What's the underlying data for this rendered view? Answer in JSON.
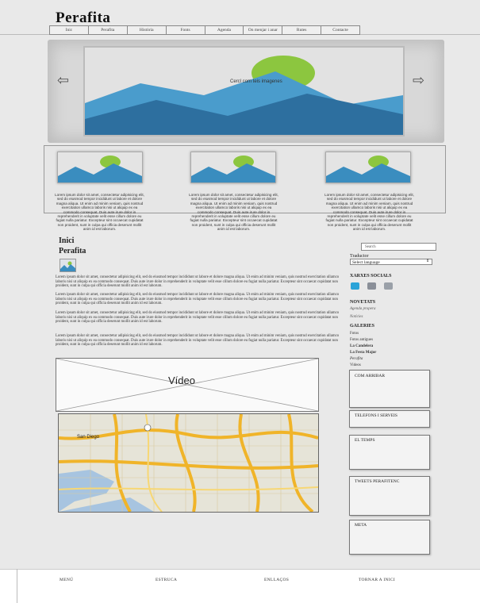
{
  "header": {
    "title": "Perafita"
  },
  "nav": {
    "items": [
      "Inic",
      "Perafita",
      "Història",
      "Fonts",
      "Agenda",
      "On menjar i anar",
      "Rutes",
      "Contacte"
    ]
  },
  "banner": {
    "caption": "Cercl com teis imagenes",
    "prev_icon": "arrow-left-icon",
    "next_icon": "arrow-right-icon"
  },
  "thumbs": [
    {
      "text": "Lorem ipsum dolor sit amet, consectetur adipisicing elit, sed do eiusmod tempor incididunt ut labore et dolore magna aliqua. Ut enim ad minim veniam, quis nostrud exercitation ullamco laboris nisi ut aliquip ex ea commodo consequat. Duis aute irure dolor in reprehenderit in voluptate velit esse cillum dolore eu fugiat nulla pariatur. Excepteur sint occaecat cupidatat non proident, sunt in culpa qui officia deserunt mollit anim id est laborum."
    },
    {
      "text": "Lorem ipsum dolor sit amet, consectetur adipisicing elit, sed do eiusmod tempor incididunt ut labore et dolore magna aliqua. Ut enim ad minim veniam, quis nostrud exercitation ullamco laboris nisi ut aliquip ex ea commodo consequat. Duis aute irure dolor in reprehenderit in voluptate velit esse cillum dolore eu fugiat nulla pariatur. Excepteur sint occaecat cupidatat non proident, sunt in culpa qui officia deserunt mollit anim id est laborum."
    },
    {
      "text": "Lorem ipsum dolor sit amet, consectetur adipisicing elit, sed do eiusmod tempor incididunt ut labore et dolore magna aliqua. Ut enim ad minim veniam, quis nostrud exercitation ullamco laboris nisi ut aliquip ex ea commodo consequat. Duis aute irure dolor in reprehenderit in voluptate velit esse cillum dolore eu fugiat nulla pariatur. Excepteur sint occaecat cupidatat non proident, sunt in culpa qui officia deserunt mollit anim id est laborum."
    }
  ],
  "main": {
    "title1": "Inici",
    "title2": "Perafita",
    "paragraphs": [
      "Lorem ipsum dolor sit amet, consectetur adipisicing elit, sed do eiusmod tempor incididunt ut labore et dolore magna aliqua. Ut enim ad minim veniam, quis nostrud exercitation ullamco laboris nisi ut aliquip ex ea commodo consequat. Duis aute irure dolor in reprehenderit in voluptate velit esse cillum dolore eu fugiat nulla pariatur. Excepteur sint occaecat cupidatat non proident, sunt in culpa qui officia deserunt mollit anim id est laborum.",
      "Lorem ipsum dolor sit amet, consectetur adipisicing elit, sed do eiusmod tempor incididunt ut labore et dolore magna aliqua. Ut enim ad minim veniam, quis nostrud exercitation ullamco laboris nisi ut aliquip ex ea commodo consequat. Duis aute irure dolor in reprehenderit in voluptate velit esse cillum dolore eu fugiat nulla pariatur. Excepteur sint occaecat cupidatat non proident, sunt in culpa qui officia deserunt mollit anim id est laborum.",
      "Lorem ipsum dolor sit amet, consectetur adipisicing elit, sed do eiusmod tempor incididunt ut labore et dolore magna aliqua. Ut enim ad minim veniam, quis nostrud exercitation ullamco laboris nisi ut aliquip ex ea commodo consequat. Duis aute irure dolor in reprehenderit in voluptate velit esse cillum dolore eu fugiat nulla pariatur. Excepteur sint occaecat cupidatat non proident, sunt in culpa qui officia deserunt mollit anim id est laborum.",
      "Lorem ipsum dolor sit amet, consectetur adipisicing elit, sed do eiusmod tempor incididunt ut labore et dolore magna aliqua. Ut enim ad minim veniam, quis nostrud exercitation ullamco laboris nisi ut aliquip ex ea commodo consequat. Duis aute irure dolor in reprehenderit in voluptate velit esse cillum dolore eu fugiat nulla pariatur. Excepteur sint occaecat cupidatat non proident, sunt in culpa qui officia deserunt mollit anim id est laborum."
    ],
    "video_label": "Vídeo",
    "map_city": "San Diego"
  },
  "sidebar": {
    "search_placeholder": "Search",
    "translator_label": "Traductor",
    "language_select": "Select language",
    "xarxes_title": "XARXES SOCIALS",
    "social_icons": [
      "twitter-icon",
      "facebook-icon",
      "flickr-icon"
    ],
    "novetats_title": "NOVETATS",
    "novetats_item": "Agenda propera",
    "noticies": "Notícies",
    "galeries_title": "GALERIES",
    "galeries": [
      "Fotos",
      "Fotos antigues",
      "La Candelera",
      "La Festa Major",
      "Perafita",
      "Videos"
    ],
    "boxes": [
      "COM ARRIBAR",
      "TELEFONS I SERVEIS",
      "EL TEMPS",
      "TWEETS PERAFITENC",
      "META"
    ]
  },
  "footer": {
    "items": [
      "MENÚ",
      "ESTRUCA",
      "ENLLAÇOS",
      "TORNAR A INICI"
    ]
  },
  "colors": {
    "background": "#e9e9e9",
    "sky": "#3a8dbf",
    "sun": "#8cc63f",
    "mountain": "#2d6f9f",
    "map_road": "#f0b429",
    "twitter": "#2aa3d8"
  }
}
